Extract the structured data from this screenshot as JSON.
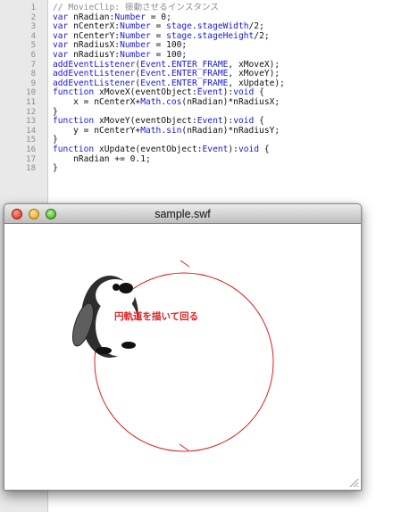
{
  "editor": {
    "lines": [
      {
        "n": "1",
        "tokens": [
          {
            "t": "// MovieClip: 振動させるインスタンス",
            "c": "comment"
          }
        ]
      },
      {
        "n": "2",
        "tokens": [
          {
            "t": "var",
            "c": "kw"
          },
          {
            "t": " nRadian:",
            "c": "plain"
          },
          {
            "t": "Number",
            "c": "type"
          },
          {
            "t": " = 0;",
            "c": "plain"
          }
        ]
      },
      {
        "n": "3",
        "tokens": [
          {
            "t": "var",
            "c": "kw"
          },
          {
            "t": " nCenterX:",
            "c": "plain"
          },
          {
            "t": "Number",
            "c": "type"
          },
          {
            "t": " = ",
            "c": "plain"
          },
          {
            "t": "stage",
            "c": "prop"
          },
          {
            "t": ".",
            "c": "plain"
          },
          {
            "t": "stageWidth",
            "c": "prop"
          },
          {
            "t": "/2;",
            "c": "plain"
          }
        ]
      },
      {
        "n": "4",
        "tokens": [
          {
            "t": "var",
            "c": "kw"
          },
          {
            "t": " nCenterY:",
            "c": "plain"
          },
          {
            "t": "Number",
            "c": "type"
          },
          {
            "t": " = ",
            "c": "plain"
          },
          {
            "t": "stage",
            "c": "prop"
          },
          {
            "t": ".",
            "c": "plain"
          },
          {
            "t": "stageHeight",
            "c": "prop"
          },
          {
            "t": "/2;",
            "c": "plain"
          }
        ]
      },
      {
        "n": "5",
        "tokens": [
          {
            "t": "var",
            "c": "kw"
          },
          {
            "t": " nRadiusX:",
            "c": "plain"
          },
          {
            "t": "Number",
            "c": "type"
          },
          {
            "t": " = 100;",
            "c": "plain"
          }
        ]
      },
      {
        "n": "6",
        "tokens": [
          {
            "t": "var",
            "c": "kw"
          },
          {
            "t": " nRadiusY:",
            "c": "plain"
          },
          {
            "t": "Number",
            "c": "type"
          },
          {
            "t": " = 100;",
            "c": "plain"
          }
        ]
      },
      {
        "n": "7",
        "tokens": [
          {
            "t": "addEventListener",
            "c": "kw"
          },
          {
            "t": "(",
            "c": "plain"
          },
          {
            "t": "Event",
            "c": "type"
          },
          {
            "t": ".",
            "c": "plain"
          },
          {
            "t": "ENTER_FRAME",
            "c": "prop"
          },
          {
            "t": ", xMoveX);",
            "c": "plain"
          }
        ]
      },
      {
        "n": "8",
        "tokens": [
          {
            "t": "addEventListener",
            "c": "kw"
          },
          {
            "t": "(",
            "c": "plain"
          },
          {
            "t": "Event",
            "c": "type"
          },
          {
            "t": ".",
            "c": "plain"
          },
          {
            "t": "ENTER_FRAME",
            "c": "prop"
          },
          {
            "t": ", xMoveY);",
            "c": "plain"
          }
        ]
      },
      {
        "n": "9",
        "tokens": [
          {
            "t": "addEventListener",
            "c": "kw"
          },
          {
            "t": "(",
            "c": "plain"
          },
          {
            "t": "Event",
            "c": "type"
          },
          {
            "t": ".",
            "c": "plain"
          },
          {
            "t": "ENTER_FRAME",
            "c": "prop"
          },
          {
            "t": ", xUpdate);",
            "c": "plain"
          }
        ]
      },
      {
        "n": "10",
        "tokens": [
          {
            "t": "function",
            "c": "kw"
          },
          {
            "t": " xMoveX(eventObject:",
            "c": "plain"
          },
          {
            "t": "Event",
            "c": "type"
          },
          {
            "t": "):",
            "c": "plain"
          },
          {
            "t": "void",
            "c": "kw"
          },
          {
            "t": " {",
            "c": "plain"
          }
        ]
      },
      {
        "n": "11",
        "tokens": [
          {
            "t": "    x = nCenterX+",
            "c": "plain"
          },
          {
            "t": "Math",
            "c": "type"
          },
          {
            "t": ".",
            "c": "plain"
          },
          {
            "t": "cos",
            "c": "prop"
          },
          {
            "t": "(nRadian)*nRadiusX;",
            "c": "plain"
          }
        ]
      },
      {
        "n": "12",
        "tokens": [
          {
            "t": "}",
            "c": "plain"
          }
        ]
      },
      {
        "n": "13",
        "tokens": [
          {
            "t": "function",
            "c": "kw"
          },
          {
            "t": " xMoveY(eventObject:",
            "c": "plain"
          },
          {
            "t": "Event",
            "c": "type"
          },
          {
            "t": "):",
            "c": "plain"
          },
          {
            "t": "void",
            "c": "kw"
          },
          {
            "t": " {",
            "c": "plain"
          }
        ]
      },
      {
        "n": "14",
        "tokens": [
          {
            "t": "    y = nCenterY+",
            "c": "plain"
          },
          {
            "t": "Math",
            "c": "type"
          },
          {
            "t": ".",
            "c": "plain"
          },
          {
            "t": "sin",
            "c": "prop"
          },
          {
            "t": "(nRadian)*nRadiusY;",
            "c": "plain"
          }
        ]
      },
      {
        "n": "15",
        "tokens": [
          {
            "t": "}",
            "c": "plain"
          }
        ]
      },
      {
        "n": "16",
        "tokens": [
          {
            "t": "function",
            "c": "kw"
          },
          {
            "t": " xUpdate(eventObject:",
            "c": "plain"
          },
          {
            "t": "Event",
            "c": "type"
          },
          {
            "t": "):",
            "c": "plain"
          },
          {
            "t": "void",
            "c": "kw"
          },
          {
            "t": " {",
            "c": "plain"
          }
        ]
      },
      {
        "n": "17",
        "tokens": [
          {
            "t": "    nRadian += 0.1;",
            "c": "plain"
          }
        ]
      },
      {
        "n": "18",
        "tokens": [
          {
            "t": "}",
            "c": "plain"
          }
        ]
      }
    ]
  },
  "window": {
    "title": "sample.swf"
  },
  "stage": {
    "annotation": "円軌道を描いて回る",
    "orbit_color": "#e02020",
    "annotation_color": "#e02020"
  },
  "colors": {
    "keyword": "#1a1ad6",
    "comment": "#8c8c8c"
  },
  "icons": [
    "close-icon",
    "minimize-icon",
    "zoom-icon",
    "penguin-icon",
    "resize-grip-icon"
  ]
}
